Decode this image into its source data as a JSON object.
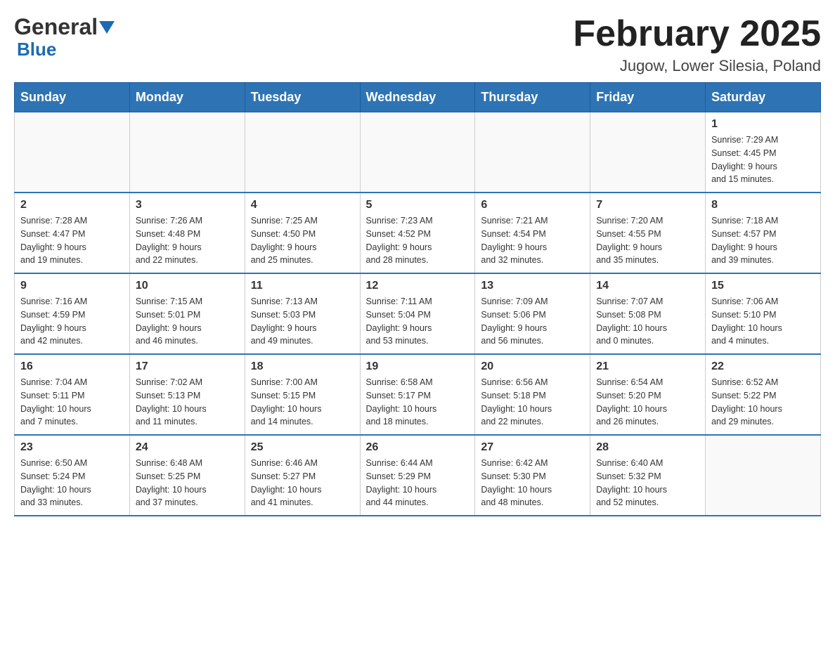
{
  "header": {
    "logo_general": "General",
    "logo_blue": "Blue",
    "month_title": "February 2025",
    "location": "Jugow, Lower Silesia, Poland"
  },
  "calendar": {
    "days_of_week": [
      "Sunday",
      "Monday",
      "Tuesday",
      "Wednesday",
      "Thursday",
      "Friday",
      "Saturday"
    ],
    "weeks": [
      [
        {
          "day": "",
          "info": ""
        },
        {
          "day": "",
          "info": ""
        },
        {
          "day": "",
          "info": ""
        },
        {
          "day": "",
          "info": ""
        },
        {
          "day": "",
          "info": ""
        },
        {
          "day": "",
          "info": ""
        },
        {
          "day": "1",
          "info": "Sunrise: 7:29 AM\nSunset: 4:45 PM\nDaylight: 9 hours\nand 15 minutes."
        }
      ],
      [
        {
          "day": "2",
          "info": "Sunrise: 7:28 AM\nSunset: 4:47 PM\nDaylight: 9 hours\nand 19 minutes."
        },
        {
          "day": "3",
          "info": "Sunrise: 7:26 AM\nSunset: 4:48 PM\nDaylight: 9 hours\nand 22 minutes."
        },
        {
          "day": "4",
          "info": "Sunrise: 7:25 AM\nSunset: 4:50 PM\nDaylight: 9 hours\nand 25 minutes."
        },
        {
          "day": "5",
          "info": "Sunrise: 7:23 AM\nSunset: 4:52 PM\nDaylight: 9 hours\nand 28 minutes."
        },
        {
          "day": "6",
          "info": "Sunrise: 7:21 AM\nSunset: 4:54 PM\nDaylight: 9 hours\nand 32 minutes."
        },
        {
          "day": "7",
          "info": "Sunrise: 7:20 AM\nSunset: 4:55 PM\nDaylight: 9 hours\nand 35 minutes."
        },
        {
          "day": "8",
          "info": "Sunrise: 7:18 AM\nSunset: 4:57 PM\nDaylight: 9 hours\nand 39 minutes."
        }
      ],
      [
        {
          "day": "9",
          "info": "Sunrise: 7:16 AM\nSunset: 4:59 PM\nDaylight: 9 hours\nand 42 minutes."
        },
        {
          "day": "10",
          "info": "Sunrise: 7:15 AM\nSunset: 5:01 PM\nDaylight: 9 hours\nand 46 minutes."
        },
        {
          "day": "11",
          "info": "Sunrise: 7:13 AM\nSunset: 5:03 PM\nDaylight: 9 hours\nand 49 minutes."
        },
        {
          "day": "12",
          "info": "Sunrise: 7:11 AM\nSunset: 5:04 PM\nDaylight: 9 hours\nand 53 minutes."
        },
        {
          "day": "13",
          "info": "Sunrise: 7:09 AM\nSunset: 5:06 PM\nDaylight: 9 hours\nand 56 minutes."
        },
        {
          "day": "14",
          "info": "Sunrise: 7:07 AM\nSunset: 5:08 PM\nDaylight: 10 hours\nand 0 minutes."
        },
        {
          "day": "15",
          "info": "Sunrise: 7:06 AM\nSunset: 5:10 PM\nDaylight: 10 hours\nand 4 minutes."
        }
      ],
      [
        {
          "day": "16",
          "info": "Sunrise: 7:04 AM\nSunset: 5:11 PM\nDaylight: 10 hours\nand 7 minutes."
        },
        {
          "day": "17",
          "info": "Sunrise: 7:02 AM\nSunset: 5:13 PM\nDaylight: 10 hours\nand 11 minutes."
        },
        {
          "day": "18",
          "info": "Sunrise: 7:00 AM\nSunset: 5:15 PM\nDaylight: 10 hours\nand 14 minutes."
        },
        {
          "day": "19",
          "info": "Sunrise: 6:58 AM\nSunset: 5:17 PM\nDaylight: 10 hours\nand 18 minutes."
        },
        {
          "day": "20",
          "info": "Sunrise: 6:56 AM\nSunset: 5:18 PM\nDaylight: 10 hours\nand 22 minutes."
        },
        {
          "day": "21",
          "info": "Sunrise: 6:54 AM\nSunset: 5:20 PM\nDaylight: 10 hours\nand 26 minutes."
        },
        {
          "day": "22",
          "info": "Sunrise: 6:52 AM\nSunset: 5:22 PM\nDaylight: 10 hours\nand 29 minutes."
        }
      ],
      [
        {
          "day": "23",
          "info": "Sunrise: 6:50 AM\nSunset: 5:24 PM\nDaylight: 10 hours\nand 33 minutes."
        },
        {
          "day": "24",
          "info": "Sunrise: 6:48 AM\nSunset: 5:25 PM\nDaylight: 10 hours\nand 37 minutes."
        },
        {
          "day": "25",
          "info": "Sunrise: 6:46 AM\nSunset: 5:27 PM\nDaylight: 10 hours\nand 41 minutes."
        },
        {
          "day": "26",
          "info": "Sunrise: 6:44 AM\nSunset: 5:29 PM\nDaylight: 10 hours\nand 44 minutes."
        },
        {
          "day": "27",
          "info": "Sunrise: 6:42 AM\nSunset: 5:30 PM\nDaylight: 10 hours\nand 48 minutes."
        },
        {
          "day": "28",
          "info": "Sunrise: 6:40 AM\nSunset: 5:32 PM\nDaylight: 10 hours\nand 52 minutes."
        },
        {
          "day": "",
          "info": ""
        }
      ]
    ]
  }
}
